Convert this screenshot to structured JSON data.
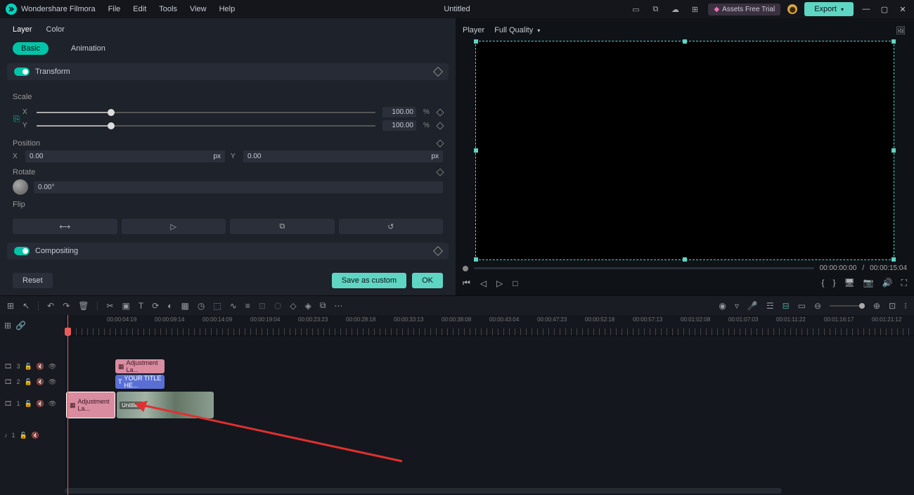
{
  "titlebar": {
    "app": "Wondershare Filmora",
    "menus": [
      "File",
      "Edit",
      "Tools",
      "View",
      "Help"
    ],
    "doc": "Untitled",
    "assets": "Assets Free Trial",
    "export": "Export"
  },
  "propPanel": {
    "tabs1": {
      "layer": "Layer",
      "color": "Color"
    },
    "tabs2": {
      "basic": "Basic",
      "animation": "Animation"
    },
    "transform": "Transform",
    "scale": "Scale",
    "scaleX": "100.00",
    "scaleY": "100.00",
    "pct": "%",
    "position": "Position",
    "posX": "0.00",
    "posY": "0.00",
    "px": "px",
    "rotate": "Rotate",
    "rotVal": "0.00°",
    "flip": "Flip",
    "compositing": "Compositing",
    "reset": "Reset",
    "save": "Save as custom",
    "ok": "OK"
  },
  "player": {
    "label": "Player",
    "quality": "Full Quality",
    "tc_cur": "00:00:00:00",
    "tc_sep": "/",
    "tc_dur": "00:00:15:04"
  },
  "ruler": {
    "labels": [
      "00:00:04:19",
      "00:00:09:14",
      "00:00:14:09",
      "00:00:19:04",
      "00:00:23:23",
      "00:00:28:18",
      "00:00:33:13",
      "00:00:38:08",
      "00:00:43:04",
      "00:00:47:23",
      "00:00:52:18",
      "00:00:57:13",
      "00:01:02:08",
      "00:01:07:03",
      "00:01:11:22",
      "00:01:16:17",
      "00:01:21:12"
    ]
  },
  "tracks": {
    "t3": "3",
    "t2": "2",
    "t1": "1",
    "a1": "1"
  },
  "clips": {
    "adj1": "Adjustment La...",
    "title": "YOUR TITLE HE...",
    "adj2": "Adjustment La...",
    "vid": "Untitled"
  }
}
